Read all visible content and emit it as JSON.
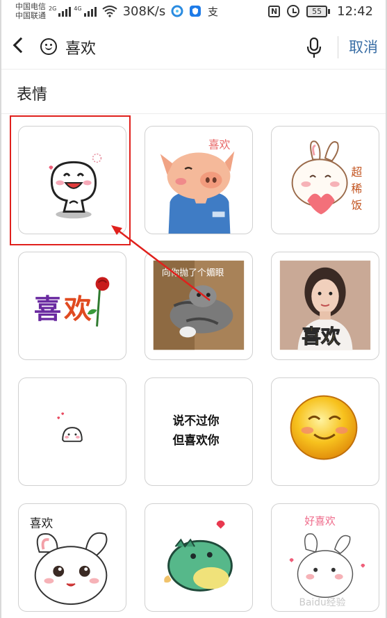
{
  "status": {
    "carrier_top": "中国电信",
    "carrier_bottom": "中国联通",
    "sig1_tag": "2G",
    "sig2_tag": "4G",
    "speed": "308K/s",
    "battery": "55",
    "time": "12:42",
    "app_icons": [
      "qq-browser-icon",
      "shield-app-icon",
      "alipay-icon"
    ]
  },
  "search": {
    "query": "喜欢",
    "cancel_label": "取消"
  },
  "section": {
    "title": "表情"
  },
  "stickers": [
    {
      "name": "sticker-white-blob-happy",
      "caption": ""
    },
    {
      "name": "sticker-pig-blushing",
      "caption": "喜欢"
    },
    {
      "name": "sticker-rabbit-heart",
      "caption": "超稀饭"
    },
    {
      "name": "sticker-xihuan-rose",
      "caption": "喜欢"
    },
    {
      "name": "sticker-cat-photo",
      "caption": "向你抛了个媚眼"
    },
    {
      "name": "sticker-girl-photo",
      "caption": "喜欢"
    },
    {
      "name": "sticker-tiny-blob",
      "caption": ""
    },
    {
      "name": "sticker-text-only",
      "caption": "说不过你",
      "caption2": "但喜欢你"
    },
    {
      "name": "sticker-yellow-smiley",
      "caption": ""
    },
    {
      "name": "sticker-bunny-eyes",
      "caption": "喜欢"
    },
    {
      "name": "sticker-green-dino",
      "caption": ""
    },
    {
      "name": "sticker-bunny-love",
      "caption": "好喜欢"
    }
  ],
  "watermark": "Baidu经验",
  "colors": {
    "accent": "#3a6ea5",
    "highlight": "#e0201c"
  }
}
